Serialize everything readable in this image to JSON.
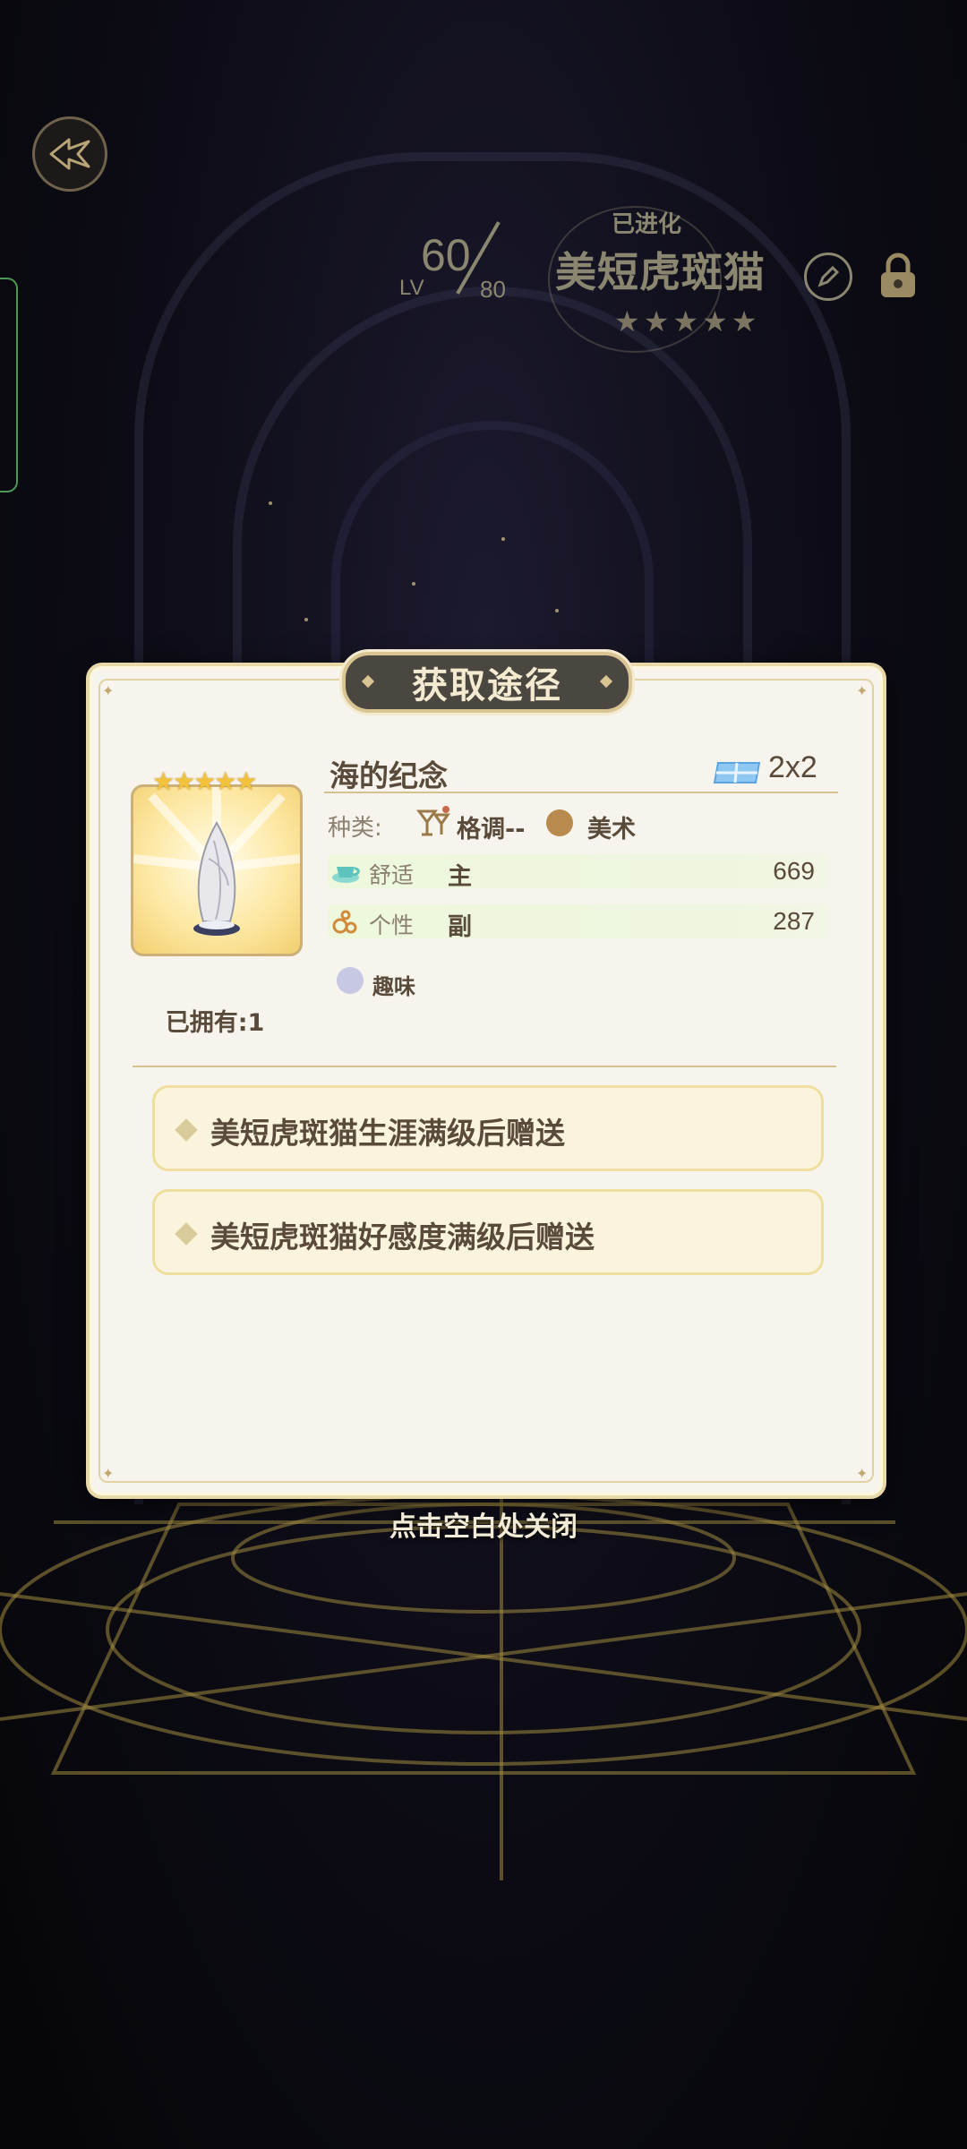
{
  "hud": {
    "level_label": "LV",
    "level_current": "60",
    "level_max": "80",
    "status_label": "已进化",
    "character_name": "美短虎斑猫",
    "character_stars": "★★★★★"
  },
  "dialog": {
    "title": "获取途径",
    "item": {
      "name": "海的纪念",
      "size": "2x2",
      "stars": "★★★★★",
      "owned_label": "已拥有:1",
      "category_label": "种类:",
      "category_value": "格调--",
      "category_value_2": "美术",
      "stats": [
        {
          "name": "舒适",
          "role": "主",
          "value": "669"
        },
        {
          "name": "个性",
          "role": "副",
          "value": "287"
        }
      ],
      "tag": "趣味"
    },
    "sources": [
      {
        "text": "美短虎斑猫生涯满级后赠送"
      },
      {
        "text": "美短虎斑猫好感度满级后赠送"
      }
    ]
  },
  "close_hint": "点击空白处关闭",
  "colors": {
    "dialog_bg": "#f7f4ee",
    "dialog_border": "#e9d9a8",
    "title_banner": "#4a4640",
    "stat_highlight": "#eef8dc",
    "source_row_bg": "#fbf4dc",
    "text_primary": "#5a4a3a"
  },
  "icons": {
    "back": "back-arrow-icon",
    "edit": "pencil-icon",
    "lock": "lock-icon",
    "size": "tile-grid-icon",
    "category": "cocktail-icon",
    "art": "palette-icon",
    "comfort": "teacup-icon",
    "personality": "bubbles-icon",
    "tag": "fun-icon"
  }
}
